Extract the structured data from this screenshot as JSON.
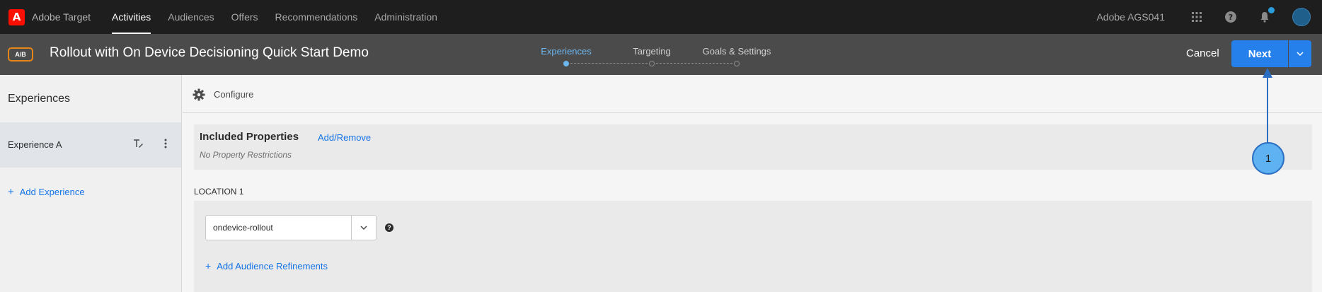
{
  "topnav": {
    "product_name": "Adobe Target",
    "items": [
      {
        "label": "Activities",
        "active": true
      },
      {
        "label": "Audiences",
        "active": false
      },
      {
        "label": "Offers",
        "active": false
      },
      {
        "label": "Recommendations",
        "active": false
      },
      {
        "label": "Administration",
        "active": false
      }
    ],
    "org_name": "Adobe AGS041",
    "icons": [
      "apps-grid-icon",
      "help-icon",
      "bell-icon",
      "avatar"
    ]
  },
  "activity_header": {
    "badge": "A/B",
    "title": "Rollout with On Device Decisioning Quick Start Demo",
    "steps": [
      {
        "label": "Experiences",
        "active": true
      },
      {
        "label": "Targeting",
        "active": false
      },
      {
        "label": "Goals & Settings",
        "active": false
      }
    ],
    "cancel_label": "Cancel",
    "next_label": "Next"
  },
  "sidebar": {
    "title": "Experiences",
    "experiences": [
      {
        "label": "Experience A",
        "selected": true
      }
    ],
    "add_label": "Add Experience"
  },
  "main": {
    "configure_label": "Configure",
    "properties": {
      "title": "Included Properties",
      "link": "Add/Remove",
      "subtitle": "No Property Restrictions"
    },
    "location": {
      "label": "LOCATION 1",
      "mbox_value": "ondevice-rollout",
      "help": "?",
      "add_refinements": "Add Audience Refinements"
    }
  },
  "callout": {
    "number": "1"
  },
  "colors": {
    "accent": "#2680eb",
    "link": "#1473e6",
    "active_step": "#6eb6ee",
    "badge_border": "#e68619",
    "callout_fill": "#5fb2f2"
  }
}
